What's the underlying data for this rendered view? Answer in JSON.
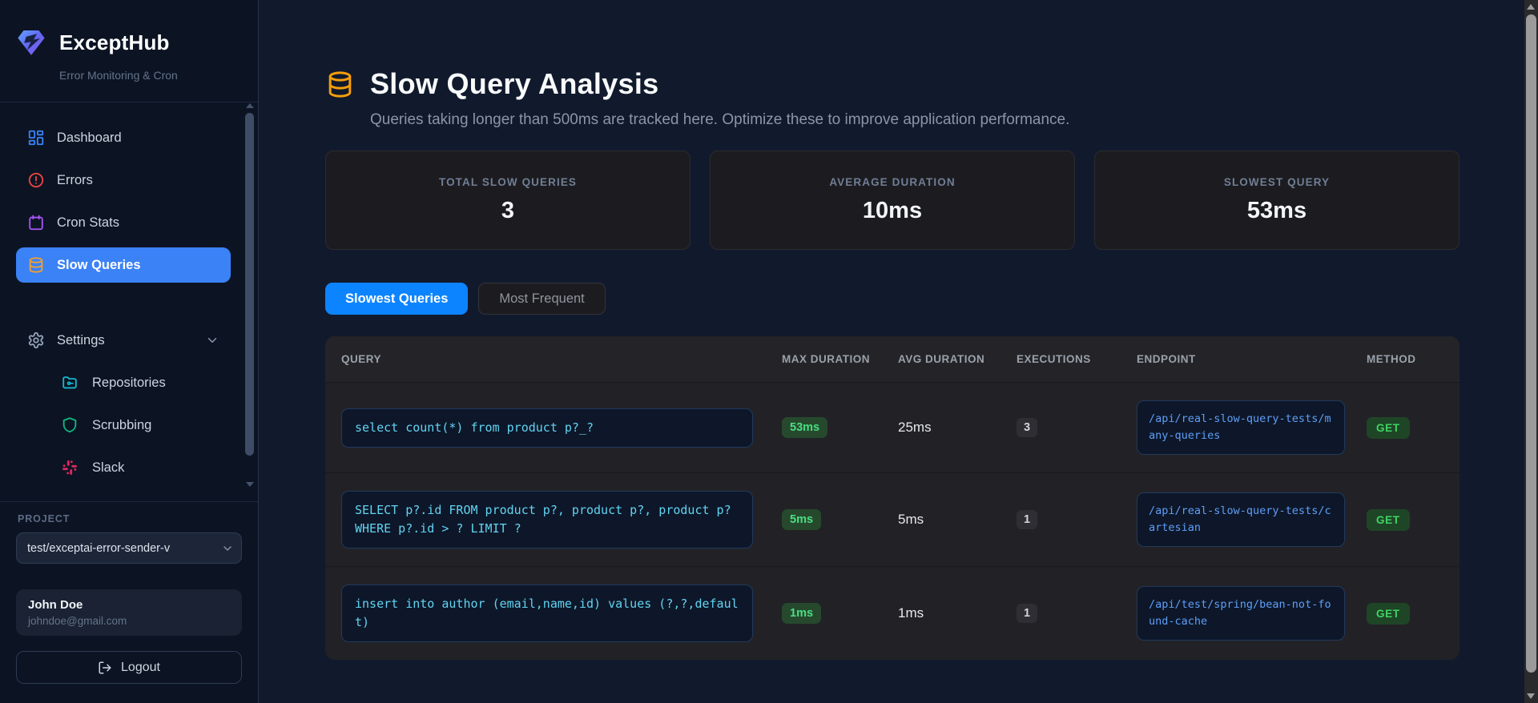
{
  "brand": {
    "name": "ExceptHub",
    "tagline": "Error Monitoring & Cron"
  },
  "sidebar": {
    "nav": [
      {
        "label": "Dashboard",
        "icon": "dashboard-grid-icon"
      },
      {
        "label": "Errors",
        "icon": "alert-circle-icon"
      },
      {
        "label": "Cron Stats",
        "icon": "calendar-icon"
      },
      {
        "label": "Slow Queries",
        "icon": "database-icon"
      }
    ],
    "settings_label": "Settings",
    "settings_children": [
      {
        "label": "Repositories",
        "icon": "folder-git-icon"
      },
      {
        "label": "Scrubbing",
        "icon": "shield-icon"
      },
      {
        "label": "Slack",
        "icon": "slack-icon"
      }
    ],
    "project_label": "PROJECT",
    "project_value": "test/exceptai-error-sender-v",
    "user": {
      "name": "John Doe",
      "email": "johndoe@gmail.com"
    },
    "logout_label": "Logout"
  },
  "header": {
    "title": "Slow Query Analysis",
    "subtitle": "Queries taking longer than 500ms are tracked here. Optimize these to improve application performance."
  },
  "stats": [
    {
      "label": "TOTAL SLOW QUERIES",
      "value": "3"
    },
    {
      "label": "AVERAGE DURATION",
      "value": "10ms"
    },
    {
      "label": "SLOWEST QUERY",
      "value": "53ms"
    }
  ],
  "tabs": [
    {
      "label": "Slowest Queries",
      "active": true
    },
    {
      "label": "Most Frequent",
      "active": false
    }
  ],
  "table": {
    "columns": [
      "QUERY",
      "MAX DURATION",
      "AVG DURATION",
      "EXECUTIONS",
      "ENDPOINT",
      "METHOD"
    ],
    "rows": [
      {
        "query": "select count(*) from product p?_?",
        "max_duration": "53ms",
        "avg_duration": "25ms",
        "executions": "3",
        "endpoint": "/api/real-slow-query-tests/many-queries",
        "method": "GET"
      },
      {
        "query": "SELECT p?.id FROM product p?, product p?, product p? WHERE p?.id > ? LIMIT ?",
        "max_duration": "5ms",
        "avg_duration": "5ms",
        "executions": "1",
        "endpoint": "/api/real-slow-query-tests/cartesian",
        "method": "GET"
      },
      {
        "query": "insert into author (email,name,id) values (?,?,default)",
        "max_duration": "1ms",
        "avg_duration": "1ms",
        "executions": "1",
        "endpoint": "/api/test/spring/bean-not-found-cache",
        "method": "GET"
      }
    ]
  },
  "colors": {
    "accent_blue": "#3b82f6",
    "tab_blue": "#0d84ff",
    "badge_green": "#4ade80",
    "query_cyan": "#62d3f1",
    "endpoint_blue": "#5f9ef7",
    "database_amber": "#f59e0b",
    "error_red": "#ef4444",
    "cron_purple": "#a855f7",
    "repo_teal": "#14b8cf",
    "shield_green": "#10b981",
    "slack_pink": "#e0265e"
  }
}
